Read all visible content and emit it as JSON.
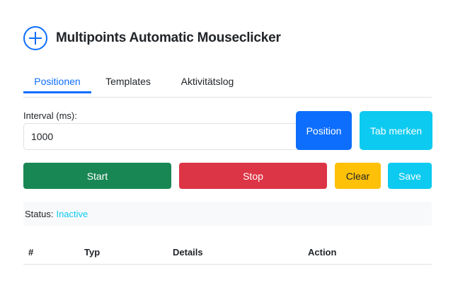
{
  "header": {
    "title": "Multipoints Automatic Mouseclicker",
    "icon": "crosshair-plus-icon",
    "accent_color": "#0d6efd"
  },
  "tabs": [
    {
      "label": "Positionen",
      "active": true
    },
    {
      "label": "Templates",
      "active": false
    },
    {
      "label": "Aktivitätslog",
      "active": false
    }
  ],
  "interval": {
    "label": "Interval (ms):",
    "value": "1000"
  },
  "buttons": {
    "position": "Position",
    "tab_merken": "Tab merken",
    "start": "Start",
    "stop": "Stop",
    "clear": "Clear",
    "save": "Save"
  },
  "status": {
    "label": "Status:",
    "value": "Inactive"
  },
  "table": {
    "columns": [
      "#",
      "Typ",
      "Details",
      "Action"
    ],
    "rows": []
  }
}
